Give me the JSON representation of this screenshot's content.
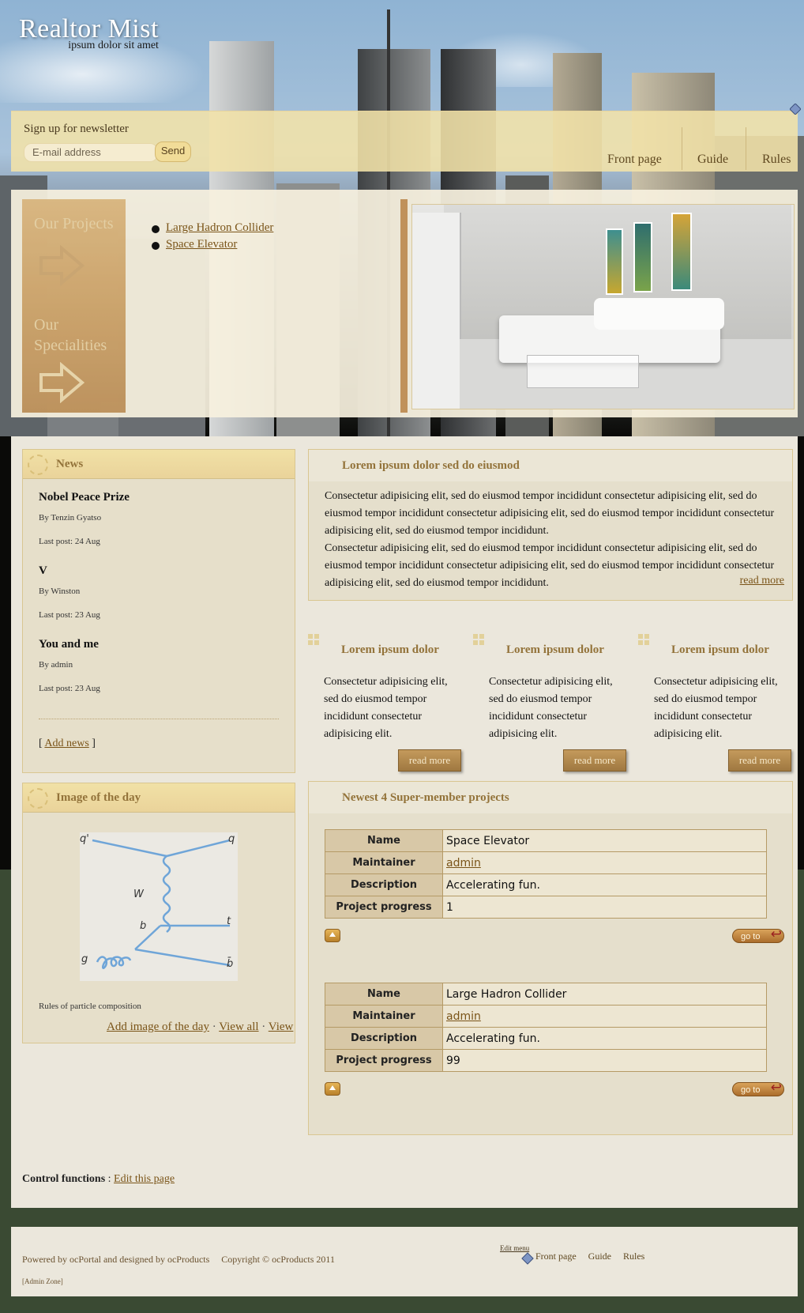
{
  "site": {
    "title": "Realtor Mist",
    "tagline": "ipsum dolor sit amet"
  },
  "newsletter": {
    "label": "Sign up for newsletter",
    "placeholder": "E-mail address",
    "send_label": "Send"
  },
  "nav": [
    "Front page",
    "Guide",
    "Rules"
  ],
  "feature": {
    "side_headings": [
      "Our Projects",
      "Our Specialities"
    ],
    "projects": [
      "Large Hadron Collider",
      "Space Elevator"
    ]
  },
  "news": {
    "title": "News",
    "items": [
      {
        "headline": "Nobel Peace Prize",
        "by": "By Tenzin Gyatso",
        "last": "Last post: 24 Aug"
      },
      {
        "headline": "V",
        "by": "By Winston",
        "last": "Last post: 23 Aug"
      },
      {
        "headline": "You and me",
        "by": "By admin",
        "last": "Last post: 23 Aug"
      }
    ],
    "add_prefix": "[",
    "add_label": "Add news",
    "add_suffix": "]"
  },
  "iotd": {
    "title": "Image of the day",
    "diagram_labels": [
      "q'",
      "q",
      "W",
      "b",
      "t",
      "g",
      "b̄"
    ],
    "caption": "Rules of particle composition",
    "links": [
      "Add image of the day",
      "View all",
      "View"
    ],
    "sep": "·"
  },
  "intro": {
    "title": "Lorem ipsum dolor sed do eiusmod",
    "para1": "Consectetur adipisicing elit, sed do eiusmod tempor incididunt consectetur adipisicing elit, sed do eiusmod tempor incididunt consectetur adipisicing elit, sed do eiusmod tempor incididunt consectetur adipisicing elit, sed do eiusmod tempor incididunt.",
    "para2": "Consectetur adipisicing elit, sed do eiusmod tempor incididunt consectetur adipisicing elit, sed do eiusmod tempor incididunt consectetur adipisicing elit, sed do eiusmod tempor incididunt consectetur adipisicing elit, sed do eiusmod tempor incididunt.",
    "read_more": "read more"
  },
  "columns": [
    {
      "title": "Lorem ipsum dolor",
      "text": "Consectetur adipisicing elit, sed do eiusmod tempor incididunt consectetur adipisicing elit.",
      "button": "read more"
    },
    {
      "title": "Lorem ipsum dolor",
      "text": "Consectetur adipisicing elit, sed do eiusmod tempor incididunt consectetur adipisicing elit.",
      "button": "read more"
    },
    {
      "title": "Lorem ipsum dolor",
      "text": "Consectetur adipisicing elit, sed do eiusmod tempor incididunt consectetur adipisicing elit.",
      "button": "read more"
    }
  ],
  "projects_box": {
    "title": "Newest 4 Super-member projects",
    "keys": [
      "Name",
      "Maintainer",
      "Description",
      "Project progress"
    ],
    "rows": [
      {
        "name": "Space Elevator",
        "maintainer": "admin",
        "description": "Accelerating fun.",
        "progress": "1"
      },
      {
        "name": "Large Hadron Collider",
        "maintainer": "admin",
        "description": "Accelerating fun.",
        "progress": "99"
      }
    ],
    "goto_label": "go to"
  },
  "control": {
    "label": "Control functions",
    "sep": ":",
    "link": "Edit this page"
  },
  "footer": {
    "powered": "Powered by ocPortal and designed by ocProducts",
    "copyright": "Copyright © ocProducts 2011",
    "admin": "[Admin Zone]",
    "edit_menu": "Edit menu",
    "nav": [
      "Front page",
      "Guide",
      "Rules"
    ]
  }
}
